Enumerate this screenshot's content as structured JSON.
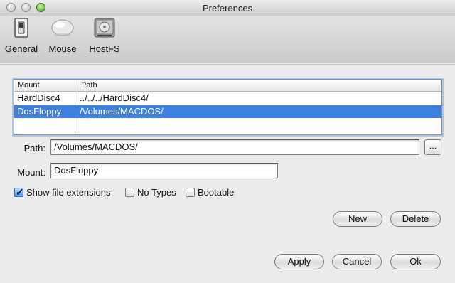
{
  "window": {
    "title": "Preferences"
  },
  "toolbar": {
    "items": [
      {
        "label": "General",
        "icon": "switch-icon"
      },
      {
        "label": "Mouse",
        "icon": "mouse-icon"
      },
      {
        "label": "HostFS",
        "icon": "hard-drive-icon"
      }
    ]
  },
  "table": {
    "columns": [
      "Mount",
      "Path"
    ],
    "rows": [
      {
        "mount": "HardDisc4",
        "path": "../../../HardDisc4/",
        "selected": false
      },
      {
        "mount": "DosFloppy",
        "path": "/Volumes/MACDOS/",
        "selected": true
      }
    ]
  },
  "form": {
    "path_label": "Path:",
    "path_value": "/Volumes/MACDOS/",
    "browse_label": "...",
    "mount_label": "Mount:",
    "mount_value": "DosFloppy"
  },
  "options": {
    "show_ext_label": "Show file extensions",
    "show_ext_checked": true,
    "no_types_label": "No Types",
    "no_types_checked": false,
    "bootable_label": "Bootable",
    "bootable_checked": false
  },
  "buttons": {
    "new_label": "New",
    "delete_label": "Delete",
    "apply_label": "Apply",
    "cancel_label": "Cancel",
    "ok_label": "Ok"
  },
  "colors": {
    "selection": "#3d80df",
    "focus_ring": "#a9c7ea"
  }
}
